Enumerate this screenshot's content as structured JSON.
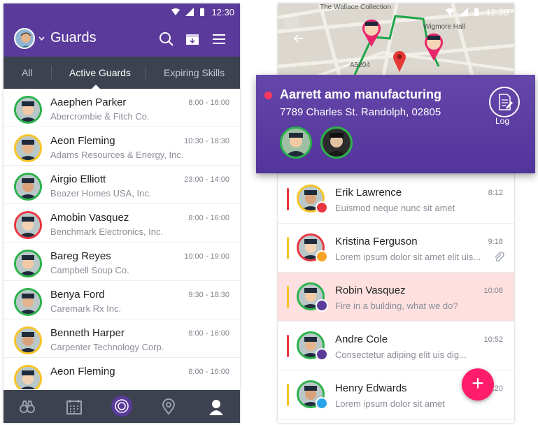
{
  "status": {
    "time": "12:30"
  },
  "left": {
    "header": {
      "title": "Guards"
    },
    "tabs": [
      "All",
      "Active Guards",
      "Expiring Skills"
    ],
    "guards": [
      {
        "name": "Aaephen Parker",
        "company": "Abercrombie & Fitch Co.",
        "time": "8:00 - 16:00",
        "ring": "#2ab24a"
      },
      {
        "name": "Aeon Fleming",
        "company": "Adams Resources & Energy, Inc.",
        "time": "10:30 - 18:30",
        "ring": "#f7c325"
      },
      {
        "name": "Airgio Elliott",
        "company": "Beazer Homes USA, Inc.",
        "time": "23:00 - 14:00",
        "ring": "#2ab24a"
      },
      {
        "name": "Amobin Vasquez",
        "company": "Benchmark Electronics, Inc.",
        "time": "8:00 - 16:00",
        "ring": "#e8353f"
      },
      {
        "name": "Bareg Reyes",
        "company": "Campbell Soup Co.",
        "time": "10:00 - 19:00",
        "ring": "#2ab24a"
      },
      {
        "name": "Benya Ford",
        "company": "Caremark Rx Inc.",
        "time": "9:30 - 18:30",
        "ring": "#2ab24a"
      },
      {
        "name": "Benneth Harper",
        "company": "Carpenter Technology Corp.",
        "time": "8:00 - 16:00",
        "ring": "#f7c325"
      },
      {
        "name": "Aeon Fleming",
        "company": "",
        "time": "8:00 - 16:00",
        "ring": "#f7c325"
      }
    ]
  },
  "right": {
    "map": {
      "labels": [
        "The Wallace Collection",
        "Wigmore Hall",
        "A5204"
      ]
    },
    "card": {
      "title": "Aarrett amo manufacturing",
      "address": "7789 Charles St. Randolph, 02805",
      "log_label": "Log"
    },
    "messages": [
      {
        "name": "Erik Lawrence",
        "text": "Euismod neque nunc sit amet",
        "time": "8:12",
        "bar": "#e8353f",
        "ring": "#f7c325",
        "badge": "#e8353f",
        "highlight": false
      },
      {
        "name": "Kristina Ferguson",
        "text": "Lorem ipsum dolor sit amet elit uis...",
        "time": "9:18",
        "bar": "#f7c325",
        "ring": "#e8353f",
        "badge": "#f7a325",
        "highlight": false,
        "attachment": true
      },
      {
        "name": "Robin Vasquez",
        "text": "Fire in a building, what we do?",
        "time": "10:08",
        "bar": "#f7c325",
        "ring": "#2ab24a",
        "badge": "#5a3a9a",
        "highlight": true
      },
      {
        "name": "Andre Cole",
        "text": "Consectetur adiping elit uis dig...",
        "time": "10:52",
        "bar": "#e8353f",
        "ring": "#2ab24a",
        "badge": "#5a3a9a",
        "highlight": false
      },
      {
        "name": "Henry Edwards",
        "text": "Lorem ipsum dolor sit amet",
        "time": "11:20",
        "bar": "#f7c325",
        "ring": "#2ab24a",
        "badge": "#2aa6e8",
        "highlight": false
      }
    ],
    "fab_label": "+"
  }
}
